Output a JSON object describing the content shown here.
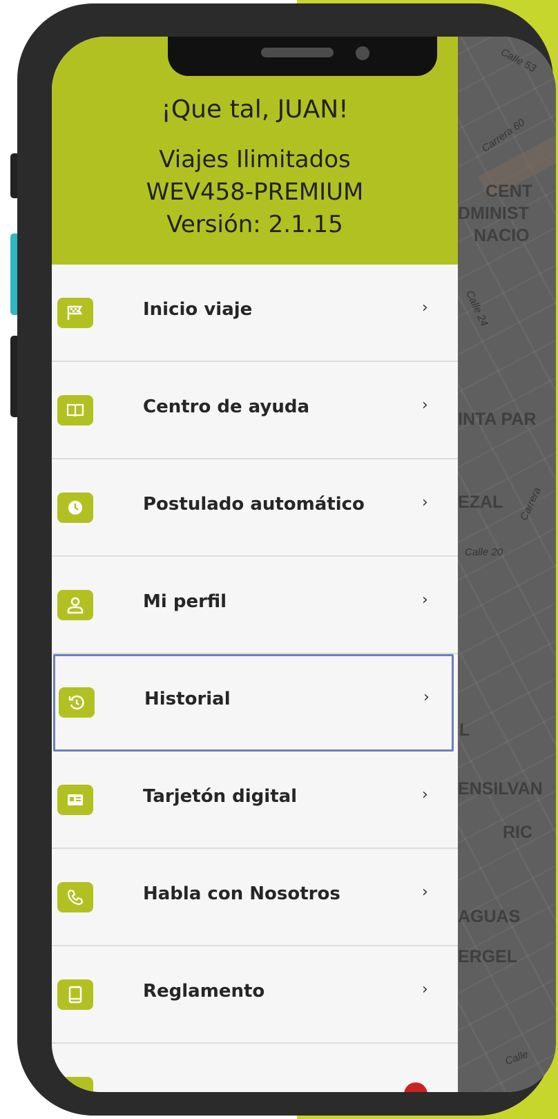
{
  "header": {
    "greeting": "¡Que tal, JUAN!",
    "plan_line1": "Viajes Ilimitados",
    "plan_line2": "WEV458-PREMIUM",
    "version": "Versión: 2.1.15"
  },
  "menu": {
    "items": [
      {
        "label": "Inicio viaje",
        "icon": "flag-icon",
        "chevron": "›"
      },
      {
        "label": "Centro de ayuda",
        "icon": "book-icon",
        "chevron": "›"
      },
      {
        "label": "Postulado automático",
        "icon": "clock-icon",
        "chevron": "›"
      },
      {
        "label": "Mi perfil",
        "icon": "user-icon",
        "chevron": "›"
      },
      {
        "label": "Historial",
        "icon": "history-icon",
        "chevron": "›",
        "selected": true
      },
      {
        "label": "Tarjetón digital",
        "icon": "id-card-icon",
        "chevron": "›"
      },
      {
        "label": "Habla con Nosotros",
        "icon": "phone-icon",
        "chevron": "›"
      },
      {
        "label": "Reglamento",
        "icon": "document-icon",
        "chevron": "›"
      }
    ]
  },
  "map": {
    "labels": [
      "Calle 53",
      "Carrera 60",
      "CENT",
      "DMINIST",
      "NACIO",
      "Calle 24",
      "INTA PAR",
      "EZAL",
      "Carrera",
      "Calle 20",
      "L",
      "ENSILVAN",
      "RIC",
      "AGUAS",
      "ERGEL",
      "Calle"
    ]
  },
  "colors": {
    "accent": "#c7d62c",
    "header": "#b2c122",
    "selection_border": "#6e7ec0"
  }
}
